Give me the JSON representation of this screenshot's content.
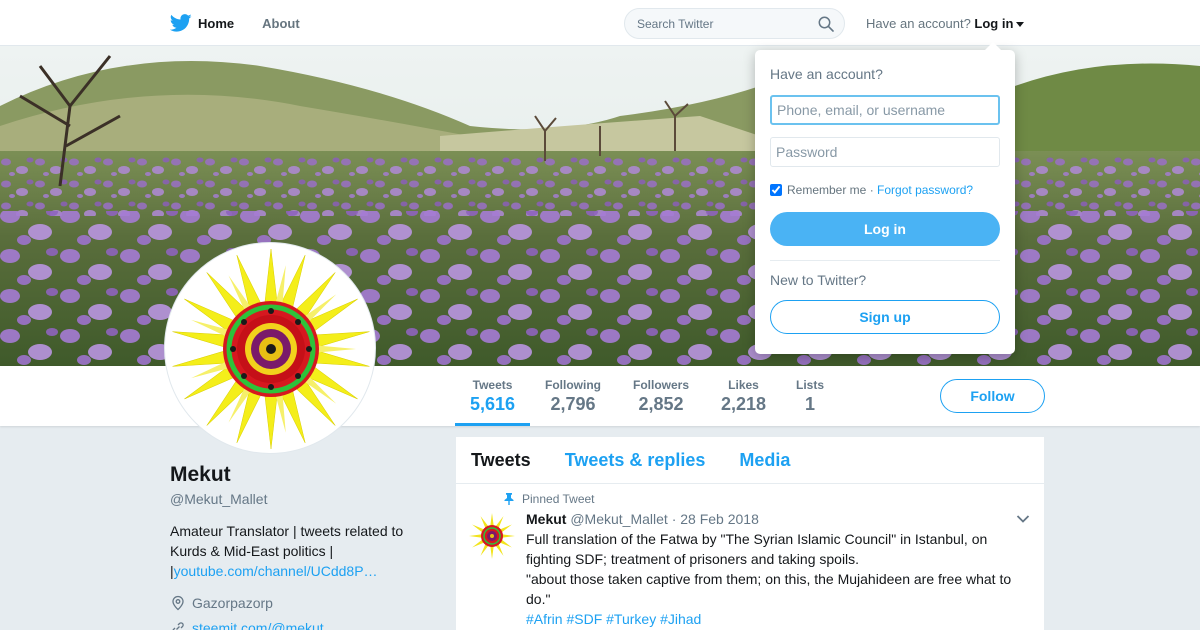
{
  "nav": {
    "home_label": "Home",
    "about_label": "About",
    "search_placeholder": "Search Twitter",
    "account_prefix": "Have an account?",
    "login_label": "Log in"
  },
  "login_dropdown": {
    "title": "Have an account?",
    "username_placeholder": "Phone, email, or username",
    "password_placeholder": "Password",
    "remember_label": "Remember me",
    "separator": "·",
    "forgot_label": "Forgot password?",
    "login_button": "Log in",
    "new_label": "New to Twitter?",
    "signup_button": "Sign up"
  },
  "profile": {
    "name": "Mekut",
    "handle": "@Mekut_Mallet",
    "bio_text": "Amateur Translator | tweets related to Kurds & Mid-East politics |",
    "bio_link": "youtube.com/channel/UCdd8P…",
    "location": "Gazorpazorp",
    "website": "steemit.com/@mekut"
  },
  "stats": [
    {
      "label": "Tweets",
      "value": "5,616"
    },
    {
      "label": "Following",
      "value": "2,796"
    },
    {
      "label": "Followers",
      "value": "2,852"
    },
    {
      "label": "Likes",
      "value": "2,218"
    },
    {
      "label": "Lists",
      "value": "1"
    }
  ],
  "follow_label": "Follow",
  "timeline": {
    "tabs": [
      "Tweets",
      "Tweets & replies",
      "Media"
    ],
    "pinned_label": "Pinned Tweet",
    "tweet": {
      "name": "Mekut",
      "handle": "@Mekut_Mallet",
      "date": "· 28 Feb 2018",
      "text_1": "Full translation of the Fatwa by \"The Syrian Islamic Council\" in Istanbul, on fighting SDF; treatment of prisoners and taking spoils.",
      "text_2": "\"about those taken captive from them; on this, the Mujahideen are free what to do.\"",
      "hashtags": "#Afrin #SDF #Turkey #Jihad"
    }
  },
  "colors": {
    "accent": "#1da1f2",
    "background": "#e6ecf0"
  }
}
